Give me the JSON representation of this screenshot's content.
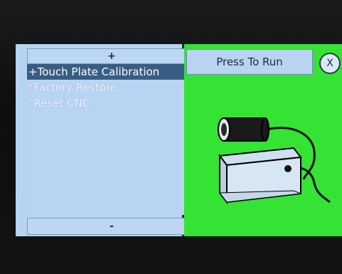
{
  "menu": {
    "scroll_up_label": "+",
    "scroll_down_label": "-",
    "items": [
      {
        "prefix": "+",
        "label": "Touch Plate Calibration",
        "selected": true
      },
      {
        "prefix": "*",
        "label": "Factory Restore",
        "selected": false
      },
      {
        "prefix": "*",
        "label": "Reset CNC",
        "selected": false
      }
    ]
  },
  "action": {
    "run_label": "Press To Run",
    "close_label": "X"
  },
  "illustration": {
    "icon": "touch-plate-icon",
    "background_color": "#35e335"
  }
}
